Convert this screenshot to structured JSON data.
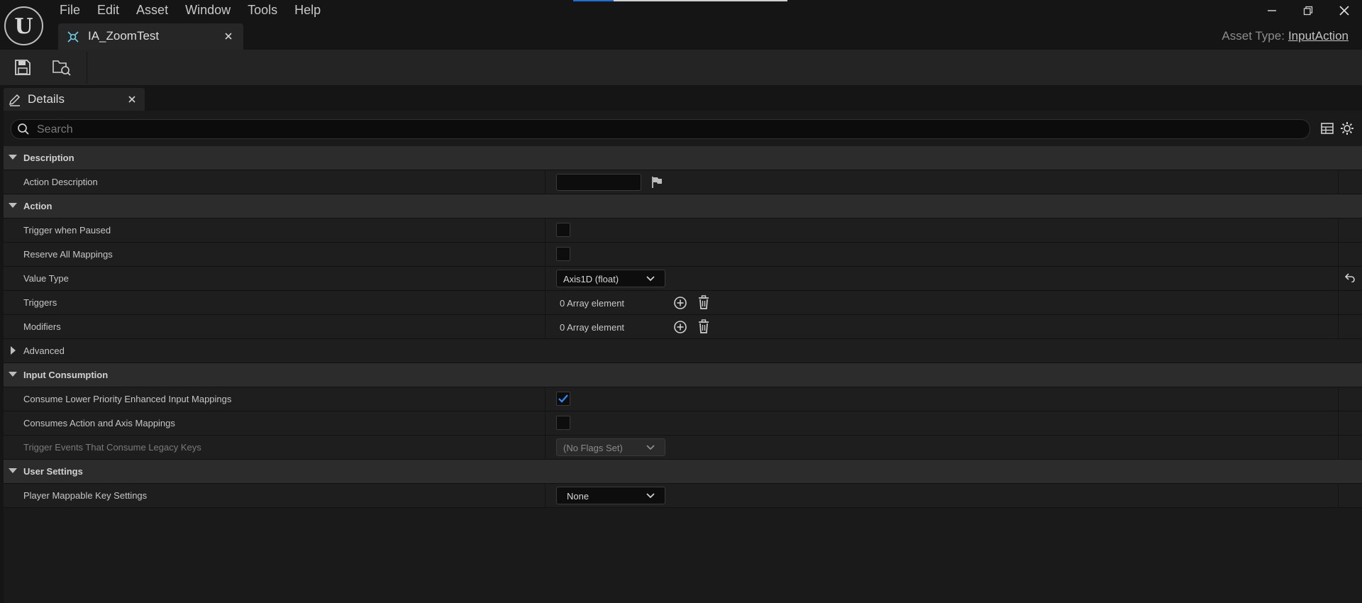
{
  "menu": [
    "File",
    "Edit",
    "Asset",
    "Window",
    "Tools",
    "Help"
  ],
  "logo": {
    "letter": "U"
  },
  "top_progress": {
    "fraction": 0.19
  },
  "document_tab": {
    "label": "IA_ZoomTest",
    "icon": "input-action-icon"
  },
  "asset_type": {
    "label": "Asset Type:",
    "value": "InputAction"
  },
  "toolbar": {
    "save": "save-icon",
    "browse": "browse-asset-icon"
  },
  "details_tab": {
    "label": "Details"
  },
  "search": {
    "placeholder": "Search"
  },
  "categories": {
    "description": "Description",
    "action": "Action",
    "advanced": "Advanced",
    "input_consumption": "Input Consumption",
    "user_settings": "User Settings"
  },
  "props": {
    "action_description": "Action Description",
    "trigger_when_paused": {
      "label": "Trigger when Paused",
      "checked": false
    },
    "reserve_all_mappings": {
      "label": "Reserve All Mappings",
      "checked": false
    },
    "value_type": {
      "label": "Value Type",
      "value": "Axis1D (float)"
    },
    "triggers": {
      "label": "Triggers",
      "value": "0 Array element"
    },
    "modifiers": {
      "label": "Modifiers",
      "value": "0 Array element"
    },
    "consume_lower": {
      "label": "Consume Lower Priority Enhanced Input Mappings",
      "checked": true
    },
    "consumes_action_axis": {
      "label": "Consumes Action and Axis Mappings",
      "checked": false
    },
    "trigger_events_legacy": {
      "label": "Trigger Events That Consume Legacy Keys",
      "value": "(No Flags Set)"
    },
    "player_mappable": {
      "label": "Player Mappable Key Settings",
      "value": "None"
    }
  },
  "colors": {
    "accent": "#1f6fd1",
    "check": "#2e8cff",
    "background": "#151515"
  }
}
